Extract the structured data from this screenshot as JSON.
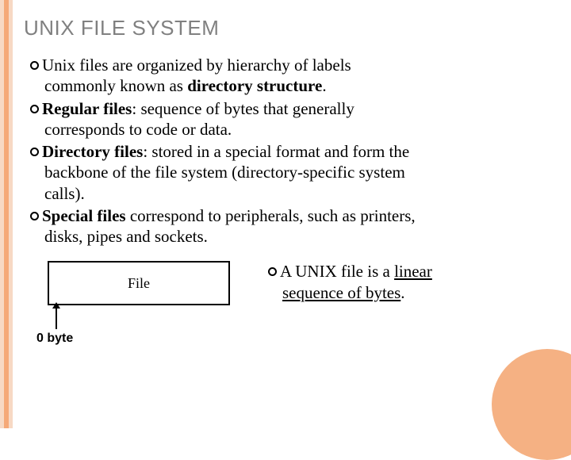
{
  "title": "UNIX FILE SYSTEM",
  "bullets": {
    "b1a": "Unix files are organized by hierarchy of labels",
    "b1b_plain": "commonly known as ",
    "b1b_bold": "directory structure",
    "b1b_end": ".",
    "b2_bold": "Regular",
    "b2_bold2": " files",
    "b2_rest": ": sequence of bytes that generally",
    "b2_line2": "corresponds to code or data.",
    "b3_bold": "Directory",
    "b3_bold2": " files",
    "b3_rest": ": stored in a special format and form the",
    "b3_line2": "backbone of the file system (directory-specific system",
    "b3_line3": "calls).",
    "b4_bold": "Special",
    "b4_bold2": " files",
    "b4_rest": " correspond to peripherals, such as printers,",
    "b4_line2": "disks, pipes and sockets."
  },
  "file_box": "File",
  "zero_byte": "0 byte",
  "bottom": {
    "pre": "A UNIX file is a ",
    "u1": "linear",
    "mid": " ",
    "u2": "sequence of bytes",
    "end": "."
  }
}
